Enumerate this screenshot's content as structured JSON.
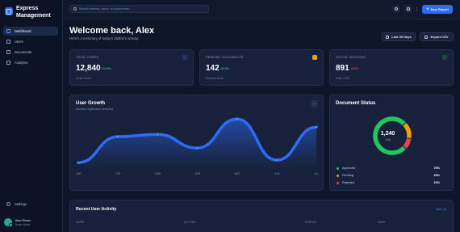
{
  "app": {
    "name": "Express Management"
  },
  "sidebar": {
    "items": [
      {
        "label": "Dashboard",
        "icon": "grid-icon",
        "active": true
      },
      {
        "label": "Users",
        "icon": "users-icon"
      },
      {
        "label": "Documents",
        "icon": "document-icon"
      },
      {
        "label": "Analytics",
        "icon": "chart-icon"
      }
    ],
    "settings": {
      "label": "Settings",
      "icon": "gear-icon"
    },
    "user": {
      "name": "Alex Rivers",
      "role": "Super Admin"
    }
  },
  "topbar": {
    "search_placeholder": "Search metrics, users, or documents...",
    "new_report_label": "New Report"
  },
  "header": {
    "title": "Welcome back, Alex",
    "subtitle": "Here's a summary of today's platform activity.",
    "range_button": "Last 30 Days",
    "export_button": "Export CSV"
  },
  "kpis": [
    {
      "label": "TOTAL USERS",
      "value": "12,840",
      "delta": "+12.5%",
      "trend": "up",
      "note": "vs last month",
      "icon": "users-icon",
      "icon_color": "#3b82f6"
    },
    {
      "label": "PENDING DOCUMENTS",
      "value": "142",
      "delta": "+8.2%",
      "trend": "up",
      "note": "Requires action",
      "icon": "folder-icon",
      "icon_color": "#f59e0b"
    },
    {
      "label": "ACTIVE SESSIONS",
      "value": "891",
      "delta": "-2.1%",
      "trend": "down",
      "note": "Peak: 1,204",
      "icon": "activity-icon",
      "icon_color": "#22c55e"
    }
  ],
  "growth": {
    "title": "User Growth",
    "subtitle": "Monthly registration analytics",
    "more_label": "…"
  },
  "chart_data": {
    "type": "area",
    "title": "User Growth",
    "x": [
      "JAN",
      "FEB",
      "MAR",
      "APR",
      "MAY",
      "JUN",
      "JUL"
    ],
    "values": [
      1.5,
      8.6,
      9.2,
      5.5,
      13.4,
      2.2,
      11.2
    ],
    "ylim": [
      0,
      15
    ],
    "grid": false,
    "color": "#2d6cf6"
  },
  "doc_status": {
    "title": "Document Status",
    "total": "1,240",
    "total_label": "Total",
    "items": [
      {
        "label": "Approved",
        "pct": "78%",
        "value": 78,
        "color": "#22c55e"
      },
      {
        "label": "Pending",
        "pct": "15%",
        "value": 15,
        "color": "#f59e0b"
      },
      {
        "label": "Rejected",
        "pct": "10%",
        "value": 10,
        "color": "#ef4444"
      }
    ]
  },
  "activity": {
    "title": "Recent User Activity",
    "view_all": "View all",
    "columns": [
      "USER",
      "ACTION",
      "STATUS",
      "DATE"
    ]
  }
}
